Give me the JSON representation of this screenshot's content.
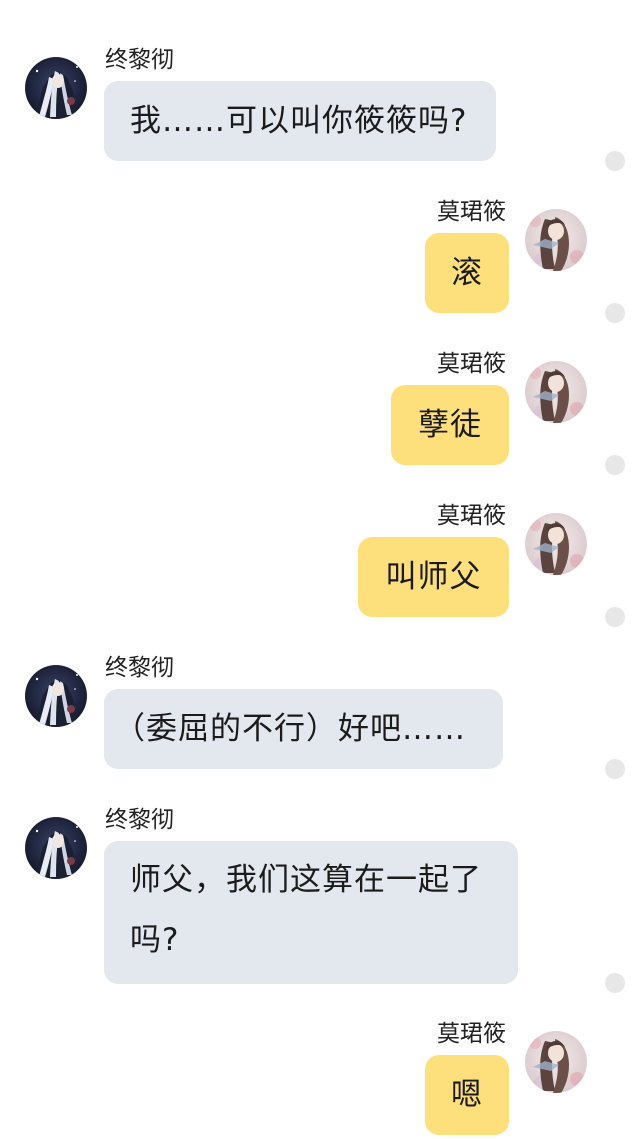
{
  "users": {
    "left_name": "终黎彻",
    "right_name": "莫珺筱"
  },
  "messages": [
    {
      "side": "left",
      "name": "终黎彻",
      "text": "我……可以叫你筱筱吗?",
      "avatar": "dark-anime-avatar"
    },
    {
      "side": "right",
      "name": "莫珺筱",
      "text": "滚",
      "avatar": "floral-anime-avatar"
    },
    {
      "side": "right",
      "name": "莫珺筱",
      "text": "孽徒",
      "avatar": "floral-anime-avatar"
    },
    {
      "side": "right",
      "name": "莫珺筱",
      "text": "叫师父",
      "avatar": "floral-anime-avatar"
    },
    {
      "side": "left",
      "name": "终黎彻",
      "text": "（委屈的不行）好吧……",
      "avatar": "dark-anime-avatar"
    },
    {
      "side": "left",
      "name": "终黎彻",
      "text_line1": "师父，我们这算在一起了",
      "text_line2": "吗?",
      "avatar": "dark-anime-avatar"
    },
    {
      "side": "right",
      "name": "莫珺筱",
      "text": "嗯",
      "avatar": "floral-anime-avatar"
    }
  ],
  "colors": {
    "left_bubble": "#e3e8ef",
    "right_bubble": "#fde07c",
    "dot": "#e7e7e7"
  }
}
